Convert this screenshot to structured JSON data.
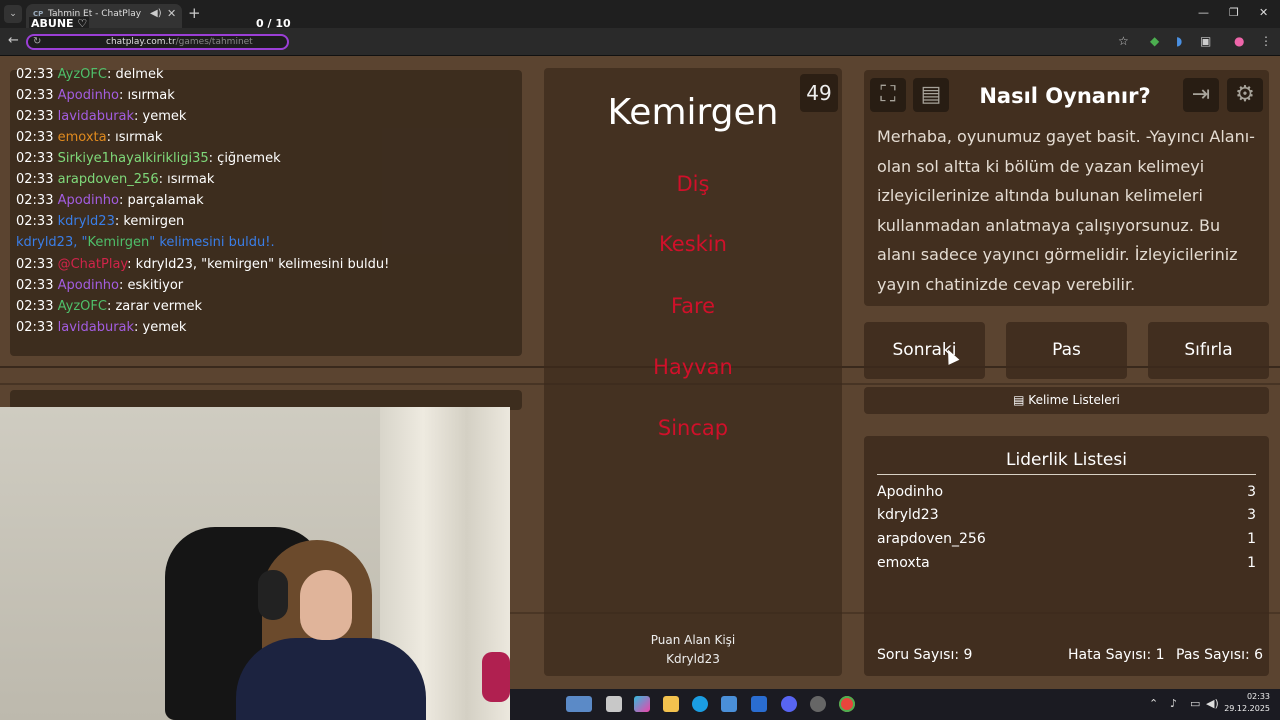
{
  "browser": {
    "tab_title": "Tahmin Et - ChatPlay",
    "tab_favicon": "CP",
    "url_domain": "chatplay.com.tr",
    "url_path": "/games/tahminet"
  },
  "overlay": {
    "abune": "ABUNE ♡",
    "counter": "0  / 10"
  },
  "chat": {
    "messages": [
      {
        "time": "02:33",
        "user": "AyzOFC",
        "color": "#4fbf6a",
        "text": ": delmek"
      },
      {
        "time": "02:33",
        "user": "Apodinho",
        "color": "#a35de0",
        "text": ": ısırmak"
      },
      {
        "time": "02:33",
        "user": "lavidaburak",
        "color": "#a35de0",
        "text": ": yemek"
      },
      {
        "time": "02:33",
        "user": "emoxta",
        "color": "#e08a1e",
        "text": ": ısırmak"
      },
      {
        "time": "02:33",
        "user": "Sirkiye1hayalkirikligi35",
        "color": "#7fd97a",
        "text": ": çiğnemek"
      },
      {
        "time": "02:33",
        "user": "arapdoven_256",
        "color": "#7fd97a",
        "text": ": ısırmak"
      },
      {
        "time": "02:33",
        "user": "Apodinho",
        "color": "#a35de0",
        "text": ": parçalamak"
      },
      {
        "time": "02:33",
        "user": "kdryld23",
        "color": "#3a7ee8",
        "text": ": kemirgen"
      },
      {
        "time": "02:33",
        "user": "@ChatPlay",
        "color": "#d0244a",
        "text": ": kdryld23, \"kemirgen\" kelimesini buldu!"
      },
      {
        "time": "02:33",
        "user": "Apodinho",
        "color": "#a35de0",
        "text": ": eskitiyor"
      },
      {
        "time": "02:33",
        "user": "AyzOFC",
        "color": "#4fbf6a",
        "text": ": zarar vermek"
      },
      {
        "time": "02:33",
        "user": "lavidaburak",
        "color": "#a35de0",
        "text": ": yemek"
      }
    ],
    "system_line": {
      "prefix": "kdryld23, \"",
      "word": "Kemirgen",
      "suffix": "\" kelimesini buldu!."
    }
  },
  "game": {
    "timer": "49",
    "word": "Kemirgen",
    "taboo_words": [
      "Diş",
      "Keskin",
      "Fare",
      "Hayvan",
      "Sincap"
    ],
    "scorer_label": "Puan Alan Kişi",
    "scorer_name": "Kdryld23"
  },
  "howto": {
    "title": "Nasıl Oynanır?",
    "text": "Merhaba, oyunumuz gayet basit. -Yayıncı Alanı- olan sol altta ki bölüm de yazan kelimeyi izleyicilerinize altında bulunan kelimeleri kullanmadan anlatmaya çalışıyorsunuz. Bu alanı sadece yayıncı görmelidir. İzleyicileriniz yayın chatinizde cevap verebilir."
  },
  "controls": {
    "next": "Sonraki",
    "pass": "Pas",
    "reset": "Sıfırla",
    "word_lists": "Kelime Listeleri"
  },
  "leaderboard": {
    "title": "Liderlik Listesi",
    "rows": [
      {
        "name": "Apodinho",
        "score": "3"
      },
      {
        "name": "kdryld23",
        "score": "3"
      },
      {
        "name": "arapdoven_256",
        "score": "1"
      },
      {
        "name": "emoxta",
        "score": "1"
      }
    ],
    "question_count": "Soru Sayısı: 9",
    "error_count": "Hata Sayısı: 1",
    "pass_count": "Pas Sayısı: 6"
  },
  "taskbar": {
    "time": "02:33",
    "date": "29.12.2025"
  }
}
